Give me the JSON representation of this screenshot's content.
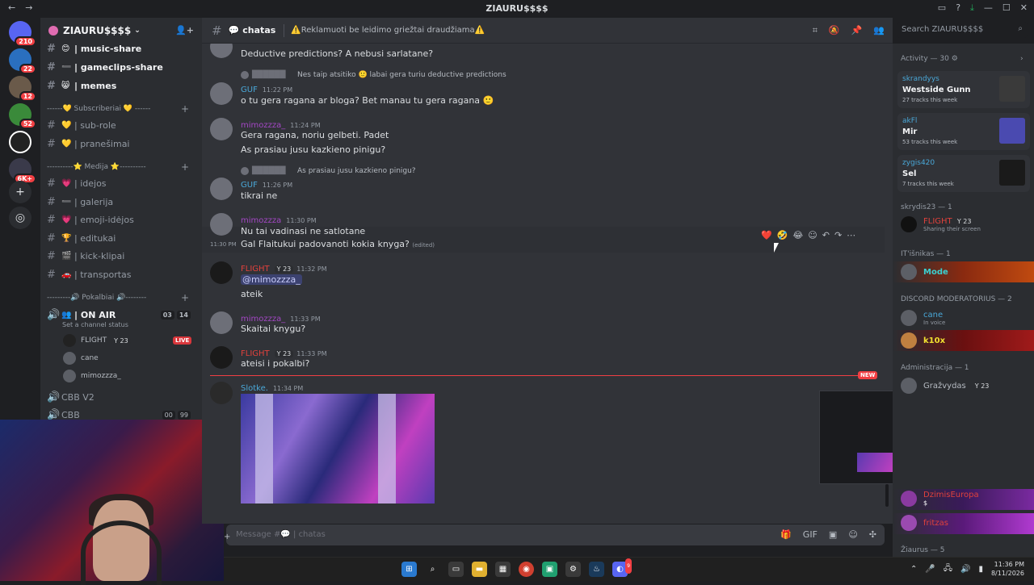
{
  "window": {
    "title": "ZIAURU$$$$",
    "back": "←",
    "forward": "→"
  },
  "server": {
    "name": "ZIAURU$$$$"
  },
  "guilds": [
    {
      "badge": "210"
    },
    {
      "badge": "22"
    },
    {
      "badge": "12"
    },
    {
      "badge": "52"
    },
    {
      "badge": ""
    },
    {
      "badge": "6K+"
    }
  ],
  "channels": {
    "top": [
      {
        "emoji": "😊",
        "name": "| music-share"
      },
      {
        "emoji": "➖",
        "name": "| gameclips-share"
      },
      {
        "emoji": "😸",
        "name": "| memes"
      }
    ],
    "cat1": "------💛 Subscriberiai 💛 ------",
    "sub": [
      {
        "emoji": "💛",
        "name": "| sub-role"
      },
      {
        "emoji": "💛",
        "name": "| pranešimai"
      }
    ],
    "cat2": "----------⭐ Medija ⭐----------",
    "media": [
      {
        "emoji": "💗",
        "name": "| idejos"
      },
      {
        "emoji": "➖",
        "name": "| galerija"
      },
      {
        "emoji": "💗",
        "name": "| emoji-idėjos"
      },
      {
        "emoji": "🏆",
        "name": "| editukai"
      },
      {
        "emoji": "🎬",
        "name": "| kick-klipai"
      },
      {
        "emoji": "🚗",
        "name": "| transportas"
      }
    ],
    "cat3": "---------🔊 Pokalbiai 🔊--------",
    "onair": {
      "name": "| ON AIR",
      "status": "Set a channel status",
      "c1": "03",
      "c2": "14"
    },
    "voice_users": [
      {
        "name": "FLIGHT",
        "tag": "Y 23",
        "live": "LIVE"
      },
      {
        "name": "cane"
      },
      {
        "name": "mimozzza_"
      }
    ],
    "cbbv2": "CBB V2",
    "cbb": {
      "name": "CBB",
      "c1": "00",
      "c2": "99"
    }
  },
  "header": {
    "channel": "chatas",
    "topic": "⚠️Reklamuoti be leidimo griežtai draudžiama⚠️",
    "search_placeholder": "Search ZIAURU$$$$"
  },
  "messages": {
    "m0": {
      "text": "Deductive predictions? A nebusi sarlatane?"
    },
    "m1": {
      "reply": "Nes taip atsitiko 🙂 labai gera turiu deductive predictions",
      "user": "GUF",
      "time": "11:22 PM",
      "text": "o tu gera ragana ar bloga? Bet manau tu gera ragana 🙂"
    },
    "m2": {
      "user": "mimozzza_",
      "time": "11:24 PM",
      "text1": "Gera ragana, noriu gelbeti. Padet",
      "text2": "As prasiau jusu kazkieno pinigu?"
    },
    "m3": {
      "reply": "As prasiau jusu kazkieno pinigu?",
      "user": "GUF",
      "time": "11:26 PM",
      "text": "tikrai ne"
    },
    "m4": {
      "user": "mimozzza",
      "time": "11:30 PM",
      "text": "Nu tai vadinasi ne satlotane"
    },
    "m5": {
      "time": "11:30 PM",
      "text": "Gal Flaitukui padovanoti kokia knyga?",
      "edited": "(edited)"
    },
    "m6": {
      "user": "FLIGHT",
      "tag": "Y 23",
      "time": "11:32 PM",
      "mention": "@mimozzza_",
      "text": "ateik"
    },
    "m7": {
      "user": "mimozzza_",
      "time": "11:33 PM",
      "text": "Skaitai knygu?"
    },
    "m8": {
      "user": "FLIGHT",
      "tag": "Y 23",
      "time": "11:33 PM",
      "text": "ateisi i pokalbi?"
    },
    "m9": {
      "user": "Slotke.",
      "time": "11:34 PM"
    },
    "new": "NEW"
  },
  "reactions": [
    "❤️",
    "🤣",
    "😂"
  ],
  "composer": {
    "placeholder": "Message #💬 | chatas"
  },
  "activity": {
    "header": "Activity — 30",
    "cards": [
      {
        "user": "skrandyys",
        "title": "Westside Gunn",
        "sub": "27 tracks this week"
      },
      {
        "user": "akFl",
        "title": "Mir",
        "sub": "53 tracks this week"
      },
      {
        "user": "zygis420",
        "title": "Sel",
        "sub": "7 tracks this week"
      }
    ]
  },
  "member_groups": {
    "g1": "skrydis23 — 1",
    "g1m": {
      "name": "FLIGHT",
      "tag": "Y 23",
      "status": "Sharing their screen"
    },
    "g2": "IT'išnikas — 1",
    "g2m": {
      "name": "Mode"
    },
    "g3": "DISCORD MODERATORIUS — 2",
    "g3m1": {
      "name": "cane",
      "status": "In voice"
    },
    "g3m2": {
      "name": "k10x"
    },
    "g4": "Administracija — 1",
    "g4m": {
      "name": "Gražvydas",
      "tag": "Y 23"
    },
    "g5m1": {
      "name": "DzimisEuropa",
      "status": "$"
    },
    "g5m2": {
      "name": "fritzas"
    },
    "g6": "Žiaurus — 5"
  },
  "taskbar": {
    "time": "11:36 PM",
    "date": "8/11/2026",
    "discord_badge": "9"
  }
}
